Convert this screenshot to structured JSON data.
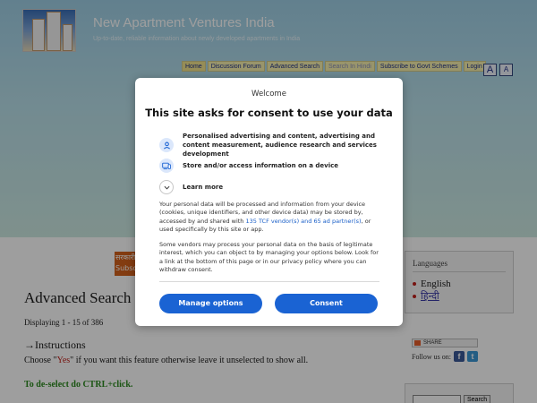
{
  "site": {
    "title": "New Apartment Ventures India",
    "tagline": "Up-to-date, reliable information about newly developed apartments in India"
  },
  "nav": {
    "items": [
      {
        "label": "Home",
        "state": "active"
      },
      {
        "label": "Discussion Forum",
        "state": "normal"
      },
      {
        "label": "Advanced Search",
        "state": "normal"
      },
      {
        "label": "Search In Hindi",
        "state": "muted"
      },
      {
        "label": "Subscribe to Govt Schemes",
        "state": "normal"
      },
      {
        "label": "Login",
        "state": "normal"
      }
    ],
    "font_size_buttons": [
      "A",
      "A"
    ]
  },
  "main": {
    "hindi_banner": "सरकारी Subscribe",
    "title": "Advanced Search",
    "displaying": "Displaying 1 - 15 of 386",
    "instructions_heading": "→Instructions",
    "choose_prefix": "Choose \"",
    "choose_yes": "Yes",
    "choose_suffix": "\" if you want this feature otherwise leave it unselected to show all.",
    "deselect_note": "To de-select do CTRL+click."
  },
  "sidebar": {
    "languages_title": "Languages",
    "languages": [
      {
        "label": "English",
        "link": false
      },
      {
        "label": "हिन्दी",
        "link": true
      }
    ],
    "share_label": "SHARE",
    "follow_label": "Follow us on:",
    "search_button": "Search"
  },
  "consent": {
    "welcome": "Welcome",
    "title": "This site asks for consent to use your data",
    "purposes": [
      {
        "icon": "person-icon",
        "text": "Personalised advertising and content, advertising and content measurement, audience research and services development"
      },
      {
        "icon": "device-icon",
        "text": "Store and/or access information on a device"
      }
    ],
    "learn_more": "Learn more",
    "para1_a": "Your personal data will be processed and information from your device (cookies, unique identifiers, and other device data) may be stored by, accessed by and shared with ",
    "para1_link": "135 TCF vendor(s) and 65 ad partner(s)",
    "para1_b": ", or used specifically by this site or app.",
    "para2": "Some vendors may process your personal data on the basis of legitimate interest, which you can object to by managing your options below. Look for a link at the bottom of this page or in our privacy policy where you can withdraw consent.",
    "manage_button": "Manage options",
    "consent_button": "Consent"
  },
  "colors": {
    "primary_button": "#1a63d3",
    "nav_background": "#f7f1ad",
    "header_gradient_top": "#9fcfe6"
  }
}
